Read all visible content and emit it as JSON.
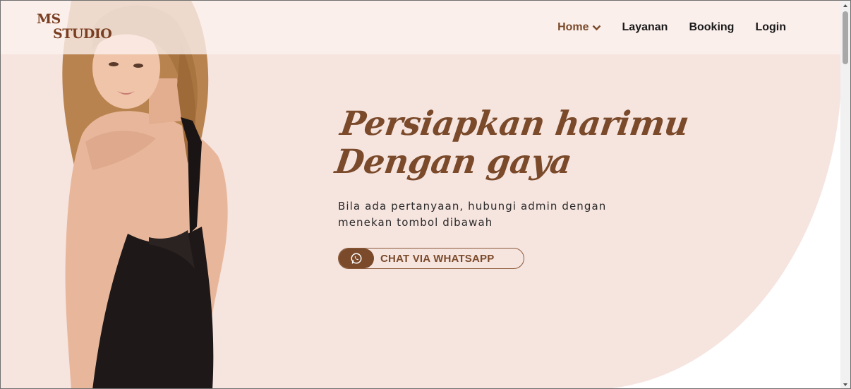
{
  "header": {
    "logo": {
      "line1": "MS",
      "line2": "STUDIO"
    },
    "nav": [
      {
        "label": "Home",
        "active": true,
        "has_dropdown": true
      },
      {
        "label": "Layanan"
      },
      {
        "label": "Booking"
      },
      {
        "label": "Login"
      }
    ]
  },
  "hero": {
    "headline_line1": "Persiapkan harimu",
    "headline_line2": "Dengan gaya",
    "subtext_line1": "Bila ada pertanyaan, hubungi admin dengan",
    "subtext_line2": "menekan tombol dibawah",
    "cta": {
      "label": "CHAT VIA WHATSAPP",
      "icon": "whatsapp-icon"
    },
    "image": "model-in-black-backless-dress"
  },
  "colors": {
    "accent": "#7a4a2a",
    "hero_bg": "#f6e4df",
    "header_bg": "#fcf2ef",
    "text": "#1a1a1a"
  }
}
